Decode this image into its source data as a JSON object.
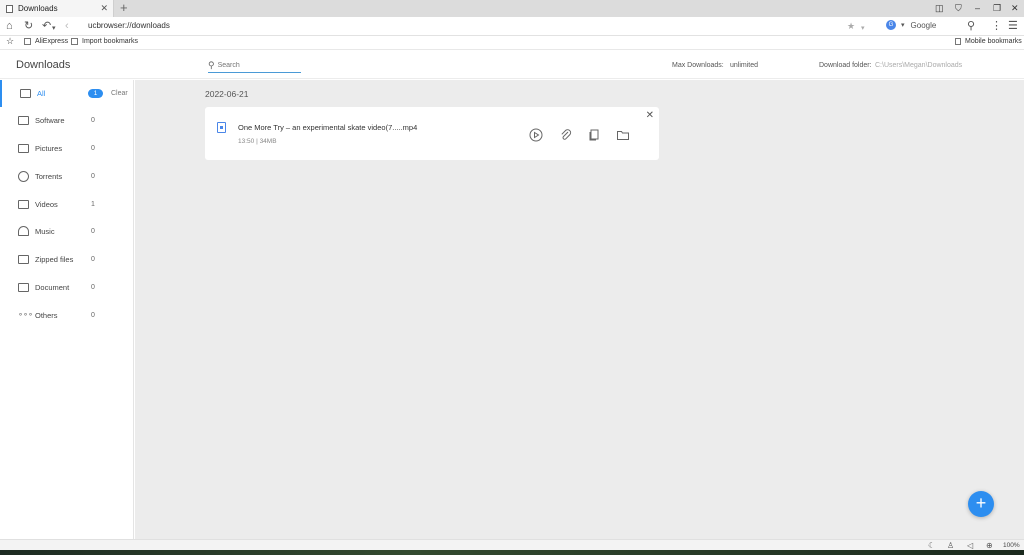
{
  "browser": {
    "tab_title": "Downloads",
    "new_tab_glyph": "+",
    "address": "ucbrowser://downloads",
    "search_engine": "Google",
    "bookmarks": [
      "AliExpress",
      "Import bookmarks"
    ],
    "mobile_bookmarks": "Mobile bookmarks"
  },
  "header": {
    "title": "Downloads",
    "search_placeholder": "Search",
    "max_downloads_label": "Max Downloads:",
    "max_downloads_value": "unlimited",
    "download_folder_label": "Download folder:",
    "download_folder_value": "C:\\Users\\Megan\\Downloads"
  },
  "sidebar": {
    "items": [
      {
        "label": "All",
        "count": "1",
        "icon": "envelope-icon"
      },
      {
        "label": "Software",
        "count": "0",
        "icon": "window-icon"
      },
      {
        "label": "Pictures",
        "count": "0",
        "icon": "image-icon"
      },
      {
        "label": "Torrents",
        "count": "0",
        "icon": "torrent-icon"
      },
      {
        "label": "Videos",
        "count": "1",
        "icon": "video-icon"
      },
      {
        "label": "Music",
        "count": "0",
        "icon": "headphones-icon"
      },
      {
        "label": "Zipped files",
        "count": "0",
        "icon": "zip-icon"
      },
      {
        "label": "Document",
        "count": "0",
        "icon": "folder-icon"
      },
      {
        "label": "Others",
        "count": "0",
        "icon": "dots-icon"
      }
    ],
    "clear_label": "Clear"
  },
  "downloads": {
    "date": "2022-06-21",
    "items": [
      {
        "filename": "One More Try – an experimental skate video(7.....mp4",
        "meta": "13:50  |  34MB"
      }
    ]
  },
  "statusbar": {
    "zoom": "100%"
  },
  "colors": {
    "accent": "#2d8ef0",
    "background": "#ececec"
  }
}
